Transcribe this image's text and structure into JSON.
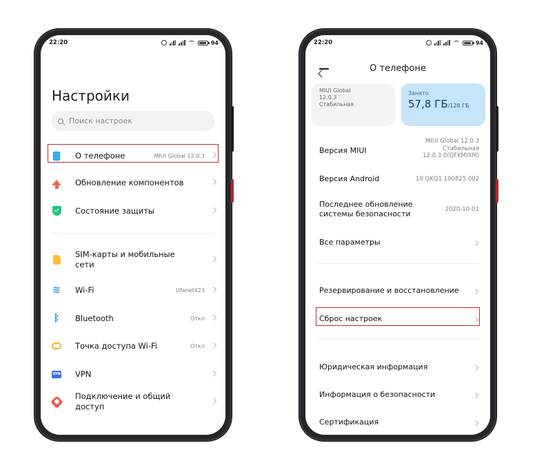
{
  "status": {
    "time": "22:20",
    "battery": "94"
  },
  "left": {
    "title": "Настройки",
    "search_placeholder": "Поиск настроек",
    "items": [
      {
        "label": "О телефоне",
        "value": "MIUI Global 12.0.3",
        "icon": "phone-icon"
      },
      {
        "label": "Обновление компонентов",
        "value": "",
        "icon": "update-arrow-icon"
      },
      {
        "label": "Состояние защиты",
        "value": "",
        "icon": "shield-icon"
      },
      {
        "label": "SIM-карты и мобильные сети",
        "value": "",
        "icon": "sim-card-icon"
      },
      {
        "label": "Wi-Fi",
        "value": "Ufanet423",
        "icon": "wifi-icon"
      },
      {
        "label": "Bluetooth",
        "value": "Откл",
        "icon": "bluetooth-icon"
      },
      {
        "label": "Точка доступа Wi-Fi",
        "value": "Откл",
        "icon": "hotspot-icon"
      },
      {
        "label": "VPN",
        "value": "",
        "icon": "vpn-icon",
        "icon_text": "VPN"
      },
      {
        "label": "Подключение и общий доступ",
        "value": "",
        "icon": "share-icon"
      }
    ]
  },
  "right": {
    "title": "О телефоне",
    "miui_card": {
      "line1": "MIUI Global",
      "line2": "12.0.3",
      "line3": "Стабильная"
    },
    "storage_card": {
      "label": "Занято",
      "used": "57,8 ГБ",
      "total": "/128 ГБ"
    },
    "info": [
      {
        "label": "Версия MIUI",
        "value": "MIUI Global 12.0.3 Стабильная 12.0.3.0(QFKMIXM)"
      },
      {
        "label": "Версия Android",
        "value": "10 QKQ1.190825.002"
      },
      {
        "label": "Последнее обновление системы безопасности",
        "value": "2020-10-01"
      },
      {
        "label": "Все параметры",
        "value": ""
      }
    ],
    "actions": [
      {
        "label": "Резервирование и восстановление"
      },
      {
        "label": "Сброс настроек"
      }
    ],
    "legal": [
      {
        "label": "Юридическая информация"
      },
      {
        "label": "Информация о безопасности"
      },
      {
        "label": "Сертификация"
      }
    ]
  },
  "colors": {
    "highlight": "#c4262e",
    "storage_card": "#c6e4fa"
  }
}
